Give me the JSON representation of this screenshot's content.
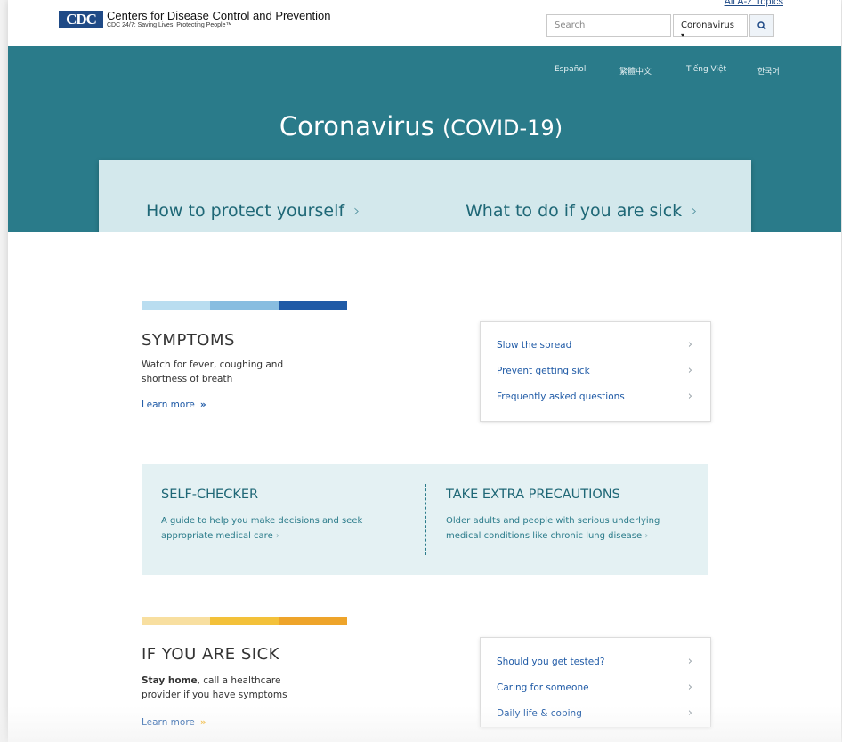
{
  "header": {
    "logo_text": "CDC",
    "org_name": "Centers for Disease Control and Prevention",
    "tagline": "CDC 24/7: Saving Lives, Protecting People™",
    "a_z_link": "All A-Z Topics",
    "search_placeholder": "Search",
    "search_scope": "Coronavirus",
    "search_scope_caret": "▾"
  },
  "languages": [
    "Español",
    "繁體中文",
    "Tiếng Việt",
    "한국어"
  ],
  "page": {
    "title_main": "Coronavirus",
    "title_sub": "(COVID-19)"
  },
  "hero": {
    "protect_link": "How to protect yourself",
    "sick_link": "What to do if you are sick",
    "chevron": "›"
  },
  "symptoms": {
    "title": "SYMPTOMS",
    "description": "Watch for fever, coughing and shortness of breath",
    "learn_more": "Learn more",
    "bar_colors": [
      "#b9ddf0",
      "#88bde0",
      "#1f5aa6"
    ],
    "links": [
      "Slow the spread",
      "Prevent getting sick",
      "Frequently asked questions"
    ]
  },
  "self_checker": {
    "title": "SELF-CHECKER",
    "description": "A guide to help you make decisions and seek appropriate medical care"
  },
  "precautions": {
    "title": "TAKE EXTRA PRECAUTIONS",
    "description": "Older adults and people with serious underlying medical conditions like chronic lung disease"
  },
  "sick": {
    "title": "IF YOU ARE SICK",
    "description_bold": "Stay home",
    "description_rest": ", call a healthcare provider if you have symptoms",
    "learn_more": "Learn more",
    "bar_colors": [
      "#f8dfa0",
      "#f3c13a",
      "#eea42a"
    ],
    "links": [
      "Should you get tested?",
      "Caring for someone",
      "Daily life & coping"
    ]
  },
  "colors": {
    "banner": "#2a7b8a",
    "link_blue": "#1f5aa6",
    "accent_yellow": "#f3b52b"
  }
}
